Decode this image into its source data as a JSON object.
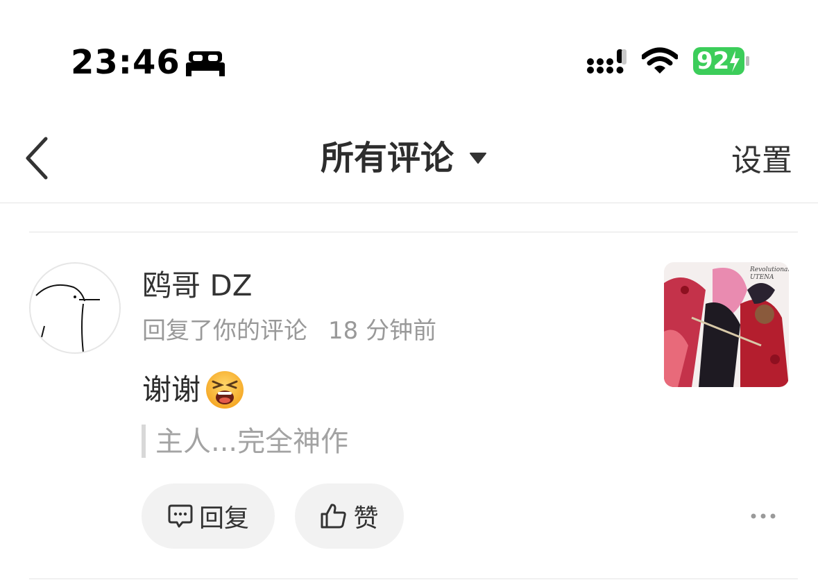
{
  "status_bar": {
    "time": "23:46",
    "battery_percent": "92"
  },
  "nav": {
    "title": "所有评论",
    "settings_label": "设置"
  },
  "comment": {
    "username": "鸥哥 DZ",
    "action": "回复了你的评论",
    "time_ago": "18 分钟前",
    "text": "谢谢",
    "quote": "主人...完全神作",
    "reply_label": "回复",
    "like_label": "赞",
    "thumbnail_caption": "Revolutionary UTENA"
  },
  "colors": {
    "battery": "#3ccd5a",
    "muted_text": "#999999",
    "pill_bg": "#f2f2f2"
  }
}
